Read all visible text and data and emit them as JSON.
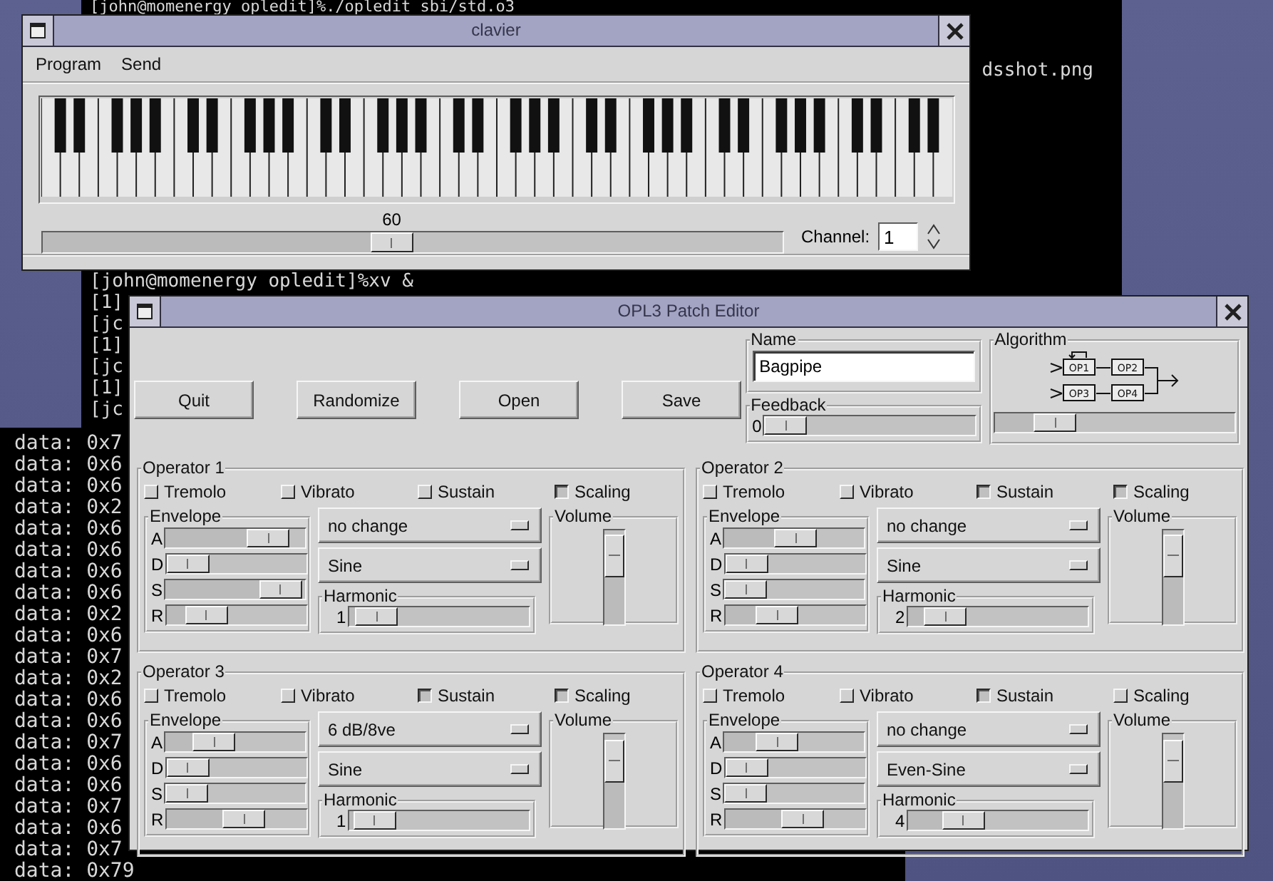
{
  "terminal_upper": {
    "first_line": "[john@momenergy opledit]%./opledit sbi/std.o3",
    "cut_line": "dsshot.png",
    "prompt_line": "[john@momenergy opledit]%xv &",
    "fragments": [
      "[1]",
      "[jc",
      "[1]",
      "[jc",
      "[1]",
      "[jc"
    ]
  },
  "terminal_lower": {
    "lines": [
      "data: 0x7",
      "data: 0x6",
      "data: 0x6",
      "data: 0x2",
      "data: 0x6",
      "data: 0x6",
      "data: 0x6",
      "data: 0x6",
      "data: 0x2",
      "data: 0x6",
      "data: 0x7",
      "data: 0x2",
      "data: 0x6",
      "data: 0x6",
      "data: 0x7",
      "data: 0x6",
      "data: 0x6",
      "data: 0x7",
      "data: 0x6",
      "data: 0x7",
      "data: 0x79"
    ]
  },
  "clavier": {
    "title": "clavier",
    "menu": [
      "Program",
      "Send"
    ],
    "note": {
      "value": "60",
      "level": 0.47
    },
    "channel": {
      "label": "Channel:",
      "value": "1"
    }
  },
  "patch_editor": {
    "title": "OPL3 Patch Editor",
    "buttons": [
      "Quit",
      "Randomize",
      "Open",
      "Save"
    ],
    "name": {
      "label": "Name",
      "value": "Bagpipe"
    },
    "feedback": {
      "label": "Feedback",
      "value": "0",
      "level": 0
    },
    "algorithm": {
      "label": "Algorithm",
      "operators": [
        "OP1",
        "OP2",
        "OP3",
        "OP4"
      ],
      "level": 0.2
    },
    "operators": [
      {
        "title": "Operator 1",
        "options": [
          {
            "label": "Tremolo",
            "checked": false
          },
          {
            "label": "Vibrato",
            "checked": false
          },
          {
            "label": "Sustain",
            "checked": false
          },
          {
            "label": "Scaling",
            "checked": true
          }
        ],
        "envelope": {
          "label": "Envelope",
          "stages": [
            {
              "label": "A",
              "level": 0.84
            },
            {
              "label": "D",
              "level": 0
            },
            {
              "label": "S",
              "level": 0.97
            },
            {
              "label": "R",
              "level": 0.19
            }
          ]
        },
        "scaling_mode": "no change",
        "waveform": "Sine",
        "harmonic": {
          "label": "Harmonic",
          "value": "1",
          "level": 0.05
        },
        "volume": {
          "label": "Volume",
          "level": 0.92
        }
      },
      {
        "title": "Operator 2",
        "options": [
          {
            "label": "Tremolo",
            "checked": false
          },
          {
            "label": "Vibrato",
            "checked": false
          },
          {
            "label": "Sustain",
            "checked": true
          },
          {
            "label": "Scaling",
            "checked": true
          }
        ],
        "envelope": {
          "label": "Envelope",
          "stages": [
            {
              "label": "A",
              "level": 0.52
            },
            {
              "label": "D",
              "level": 0
            },
            {
              "label": "S",
              "level": 0
            },
            {
              "label": "R",
              "level": 0.32
            }
          ]
        },
        "scaling_mode": "no change",
        "waveform": "Sine",
        "harmonic": {
          "label": "Harmonic",
          "value": "2",
          "level": 0.12
        },
        "volume": {
          "label": "Volume",
          "level": 0.92
        }
      },
      {
        "title": "Operator 3",
        "options": [
          {
            "label": "Tremolo",
            "checked": false
          },
          {
            "label": "Vibrato",
            "checked": false
          },
          {
            "label": "Sustain",
            "checked": true
          },
          {
            "label": "Scaling",
            "checked": true
          }
        ],
        "envelope": {
          "label": "Envelope",
          "stages": [
            {
              "label": "A",
              "level": 0.28
            },
            {
              "label": "D",
              "level": 0
            },
            {
              "label": "S",
              "level": 0
            },
            {
              "label": "R",
              "level": 0.58
            }
          ]
        },
        "scaling_mode": "6 dB/8ve",
        "waveform": "Sine",
        "harmonic": {
          "label": "Harmonic",
          "value": "1",
          "level": 0.03
        },
        "volume": {
          "label": "Volume",
          "level": 0.9
        }
      },
      {
        "title": "Operator 4",
        "options": [
          {
            "label": "Tremolo",
            "checked": false
          },
          {
            "label": "Vibrato",
            "checked": false
          },
          {
            "label": "Sustain",
            "checked": true
          },
          {
            "label": "Scaling",
            "checked": false
          }
        ],
        "envelope": {
          "label": "Envelope",
          "stages": [
            {
              "label": "A",
              "level": 0.33
            },
            {
              "label": "D",
              "level": 0
            },
            {
              "label": "S",
              "level": 0
            },
            {
              "label": "R",
              "level": 0.58
            }
          ]
        },
        "scaling_mode": "no change",
        "waveform": "Even-Sine",
        "harmonic": {
          "label": "Harmonic",
          "value": "4",
          "level": 0.25
        },
        "volume": {
          "label": "Volume",
          "level": 0.9
        }
      }
    ]
  }
}
